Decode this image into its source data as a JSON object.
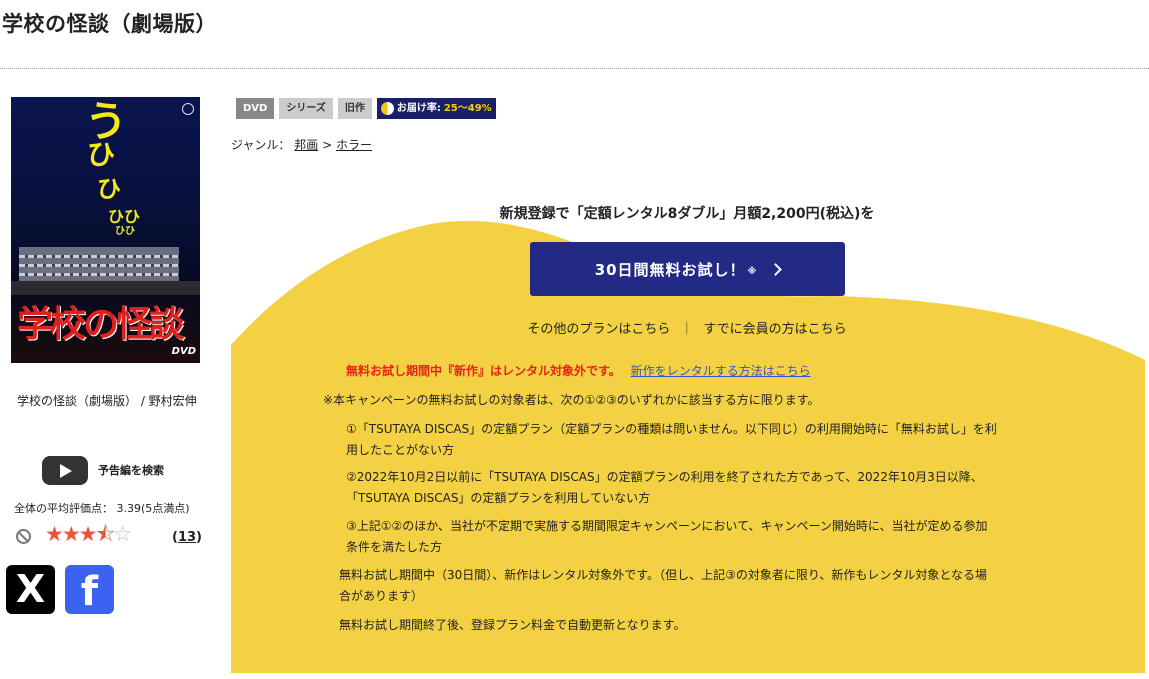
{
  "page": {
    "title": "学校の怪談（劇場版）"
  },
  "poster": {
    "caption": "学校の怪談（劇場版） / 野村宏伸",
    "art_text": [
      "う",
      "ひ",
      "ひ",
      "ひひ",
      "ひひ"
    ],
    "art_title": "学校の怪談",
    "art_logo": "DVD"
  },
  "trailer": {
    "label": "予告編を検索"
  },
  "rating": {
    "average_text": "全体の平均評価点： 3.39(5点満点)",
    "value": 3.39,
    "max": 5,
    "review_count": "13"
  },
  "social": {
    "x_label": "X",
    "facebook_label": "f"
  },
  "tags": {
    "dvd": "DVD",
    "series": "シリーズ",
    "old": "旧作",
    "delivery_label": "お届け率:",
    "delivery_rate": "25〜49%"
  },
  "genre": {
    "label": "ジャンル：",
    "category": "邦画",
    "separator": ">",
    "subcategory": "ホラー"
  },
  "promo": {
    "headline": "新規登録で「定額レンタル8ダブル」月額2,200円(税込)を",
    "trial_button": "30日間無料お試し！",
    "trial_note_mark": "※",
    "other_plans": "その他のプランはこちら",
    "link_separator": "｜",
    "member_login": "すでに会員の方はこちら",
    "warning": "無料お試し期間中『新作』はレンタル対象外です。",
    "warning_link": "新作をレンタルする方法はこちら",
    "note_intro": "※本キャンペーンの無料お試しの対象者は、次の①②③のいずれかに該当する方に限ります。",
    "note_1a": "①「TSUTAYA DISCAS」の定額プラン（定額プランの種類は問いません。以下同じ）の利用開始時に「無料お試し」を利",
    "note_1b": "用したことがない方",
    "note_2a": "②2022年10月2日以前に「TSUTAYA DISCAS」の定額プランの利用を終了された方であって、2022年10月3日以降、",
    "note_2b": "「TSUTAYA DISCAS」の定額プランを利用していない方",
    "note_3a": "③上記①②のほか、当社が不定期で実施する期間限定キャンペーンにおいて、キャンペーン開始時に、当社が定める参加",
    "note_3b": "条件を満たした方",
    "note_4a": "無料お試し期間中（30日間）、新作はレンタル対象外です。（但し、上記③の対象者に限り、新作もレンタル対象となる場",
    "note_4b": "合があります）",
    "note_5": "無料お試し期間終了後、登録プラン料金で自動更新となります。"
  },
  "colors": {
    "promo_yellow": "#f3d143",
    "button_navy": "#232a86",
    "warning_red": "#e8221c",
    "star_orange": "#e8553a"
  }
}
